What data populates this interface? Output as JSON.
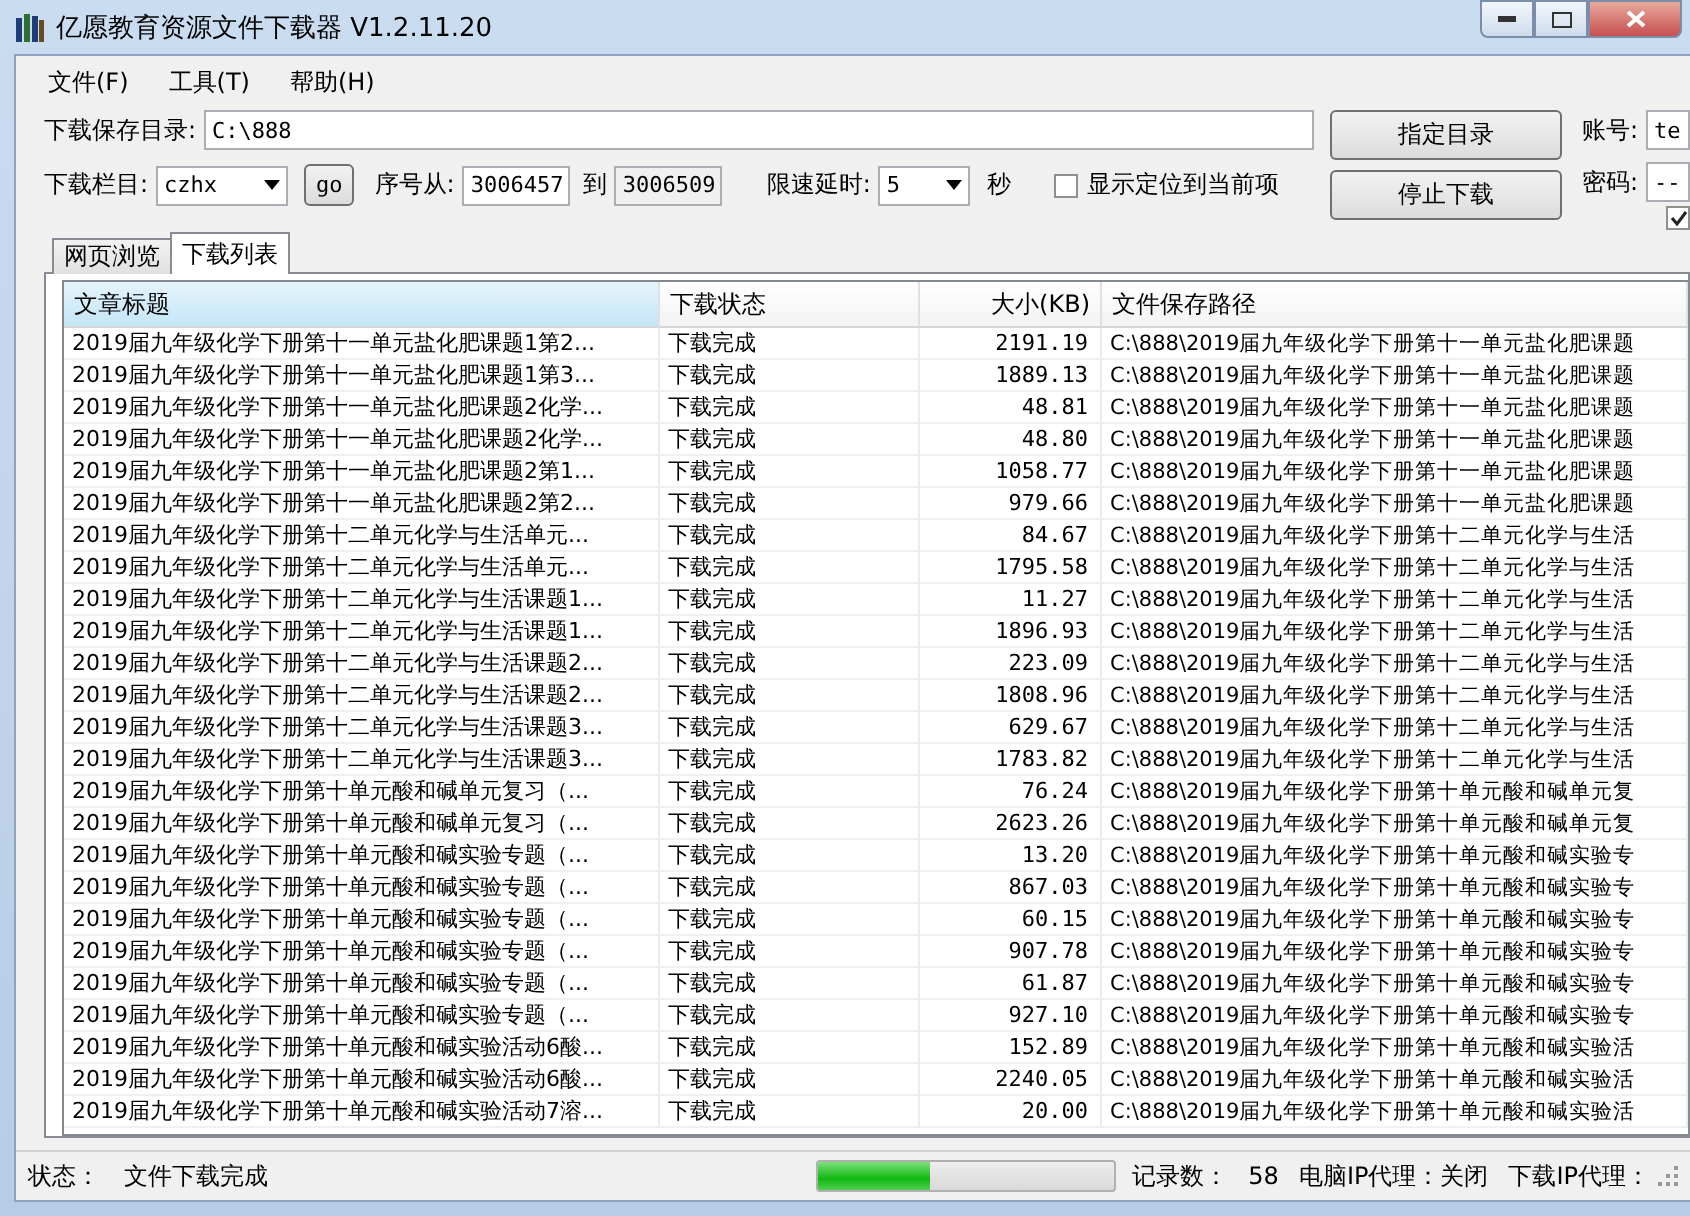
{
  "window": {
    "title": "亿愿教育资源文件下载器 V1.2.11.20"
  },
  "menu": [
    "文件(F)",
    "工具(T)",
    "帮助(H)"
  ],
  "save_dir": {
    "label": "下载保存目录:",
    "value": "C:\\888",
    "button": "指定目录"
  },
  "options": {
    "column_label": "下载栏目:",
    "column_value": "czhx",
    "go_button": "go",
    "from_label": "序号从:",
    "from_value": "3006457",
    "to_label": "到",
    "to_value": "3006509",
    "delay_label": "限速延时:",
    "delay_value": "5",
    "delay_unit": "秒",
    "locate_checkbox": {
      "label": "显示定位到当前项",
      "checked": false
    },
    "stop_button": "停止下载"
  },
  "account": {
    "label": "账号:",
    "value": "te"
  },
  "password": {
    "label": "密码:",
    "value": "--"
  },
  "side_checkbox": {
    "checked": true
  },
  "tabs": [
    {
      "label": "网页浏览",
      "selected": false
    },
    {
      "label": "下载列表",
      "selected": true
    }
  ],
  "table": {
    "columns": [
      "文章标题",
      "下载状态",
      "大小(KB)",
      "文件保存路径"
    ],
    "rows": [
      [
        "2019届九年级化学下册第十一单元盐化肥课题1第2...",
        "下载完成",
        "2191.19",
        "C:\\888\\2019届九年级化学下册第十一单元盐化肥课题"
      ],
      [
        "2019届九年级化学下册第十一单元盐化肥课题1第3...",
        "下载完成",
        "1889.13",
        "C:\\888\\2019届九年级化学下册第十一单元盐化肥课题"
      ],
      [
        "2019届九年级化学下册第十一单元盐化肥课题2化学...",
        "下载完成",
        "48.81",
        "C:\\888\\2019届九年级化学下册第十一单元盐化肥课题"
      ],
      [
        "2019届九年级化学下册第十一单元盐化肥课题2化学...",
        "下载完成",
        "48.80",
        "C:\\888\\2019届九年级化学下册第十一单元盐化肥课题"
      ],
      [
        "2019届九年级化学下册第十一单元盐化肥课题2第1...",
        "下载完成",
        "1058.77",
        "C:\\888\\2019届九年级化学下册第十一单元盐化肥课题"
      ],
      [
        "2019届九年级化学下册第十一单元盐化肥课题2第2...",
        "下载完成",
        "979.66",
        "C:\\888\\2019届九年级化学下册第十一单元盐化肥课题"
      ],
      [
        "2019届九年级化学下册第十二单元化学与生活单元...",
        "下载完成",
        "84.67",
        "C:\\888\\2019届九年级化学下册第十二单元化学与生活"
      ],
      [
        "2019届九年级化学下册第十二单元化学与生活单元...",
        "下载完成",
        "1795.58",
        "C:\\888\\2019届九年级化学下册第十二单元化学与生活"
      ],
      [
        "2019届九年级化学下册第十二单元化学与生活课题1...",
        "下载完成",
        "11.27",
        "C:\\888\\2019届九年级化学下册第十二单元化学与生活"
      ],
      [
        "2019届九年级化学下册第十二单元化学与生活课题1...",
        "下载完成",
        "1896.93",
        "C:\\888\\2019届九年级化学下册第十二单元化学与生活"
      ],
      [
        "2019届九年级化学下册第十二单元化学与生活课题2...",
        "下载完成",
        "223.09",
        "C:\\888\\2019届九年级化学下册第十二单元化学与生活"
      ],
      [
        "2019届九年级化学下册第十二单元化学与生活课题2...",
        "下载完成",
        "1808.96",
        "C:\\888\\2019届九年级化学下册第十二单元化学与生活"
      ],
      [
        "2019届九年级化学下册第十二单元化学与生活课题3...",
        "下载完成",
        "629.67",
        "C:\\888\\2019届九年级化学下册第十二单元化学与生活"
      ],
      [
        "2019届九年级化学下册第十二单元化学与生活课题3...",
        "下载完成",
        "1783.82",
        "C:\\888\\2019届九年级化学下册第十二单元化学与生活"
      ],
      [
        "2019届九年级化学下册第十单元酸和碱单元复习（...",
        "下载完成",
        "76.24",
        "C:\\888\\2019届九年级化学下册第十单元酸和碱单元复"
      ],
      [
        "2019届九年级化学下册第十单元酸和碱单元复习（...",
        "下载完成",
        "2623.26",
        "C:\\888\\2019届九年级化学下册第十单元酸和碱单元复"
      ],
      [
        "2019届九年级化学下册第十单元酸和碱实验专题（...",
        "下载完成",
        "13.20",
        "C:\\888\\2019届九年级化学下册第十单元酸和碱实验专"
      ],
      [
        "2019届九年级化学下册第十单元酸和碱实验专题（...",
        "下载完成",
        "867.03",
        "C:\\888\\2019届九年级化学下册第十单元酸和碱实验专"
      ],
      [
        "2019届九年级化学下册第十单元酸和碱实验专题（...",
        "下载完成",
        "60.15",
        "C:\\888\\2019届九年级化学下册第十单元酸和碱实验专"
      ],
      [
        "2019届九年级化学下册第十单元酸和碱实验专题（...",
        "下载完成",
        "907.78",
        "C:\\888\\2019届九年级化学下册第十单元酸和碱实验专"
      ],
      [
        "2019届九年级化学下册第十单元酸和碱实验专题（...",
        "下载完成",
        "61.87",
        "C:\\888\\2019届九年级化学下册第十单元酸和碱实验专"
      ],
      [
        "2019届九年级化学下册第十单元酸和碱实验专题（...",
        "下载完成",
        "927.10",
        "C:\\888\\2019届九年级化学下册第十单元酸和碱实验专"
      ],
      [
        "2019届九年级化学下册第十单元酸和碱实验活动6酸...",
        "下载完成",
        "152.89",
        "C:\\888\\2019届九年级化学下册第十单元酸和碱实验活"
      ],
      [
        "2019届九年级化学下册第十单元酸和碱实验活动6酸...",
        "下载完成",
        "2240.05",
        "C:\\888\\2019届九年级化学下册第十单元酸和碱实验活"
      ],
      [
        "2019届九年级化学下册第十单元酸和碱实验活动7溶...",
        "下载完成",
        "20.00",
        "C:\\888\\2019届九年级化学下册第十单元酸和碱实验活"
      ]
    ]
  },
  "status_bar": {
    "label": "状态：",
    "text": "文件下载完成",
    "progress": {
      "level": 0.38
    },
    "records_label": "记录数：",
    "records": "58",
    "pc_proxy": "电脑IP代理：关闭",
    "download_proxy": "下载IP代理："
  }
}
